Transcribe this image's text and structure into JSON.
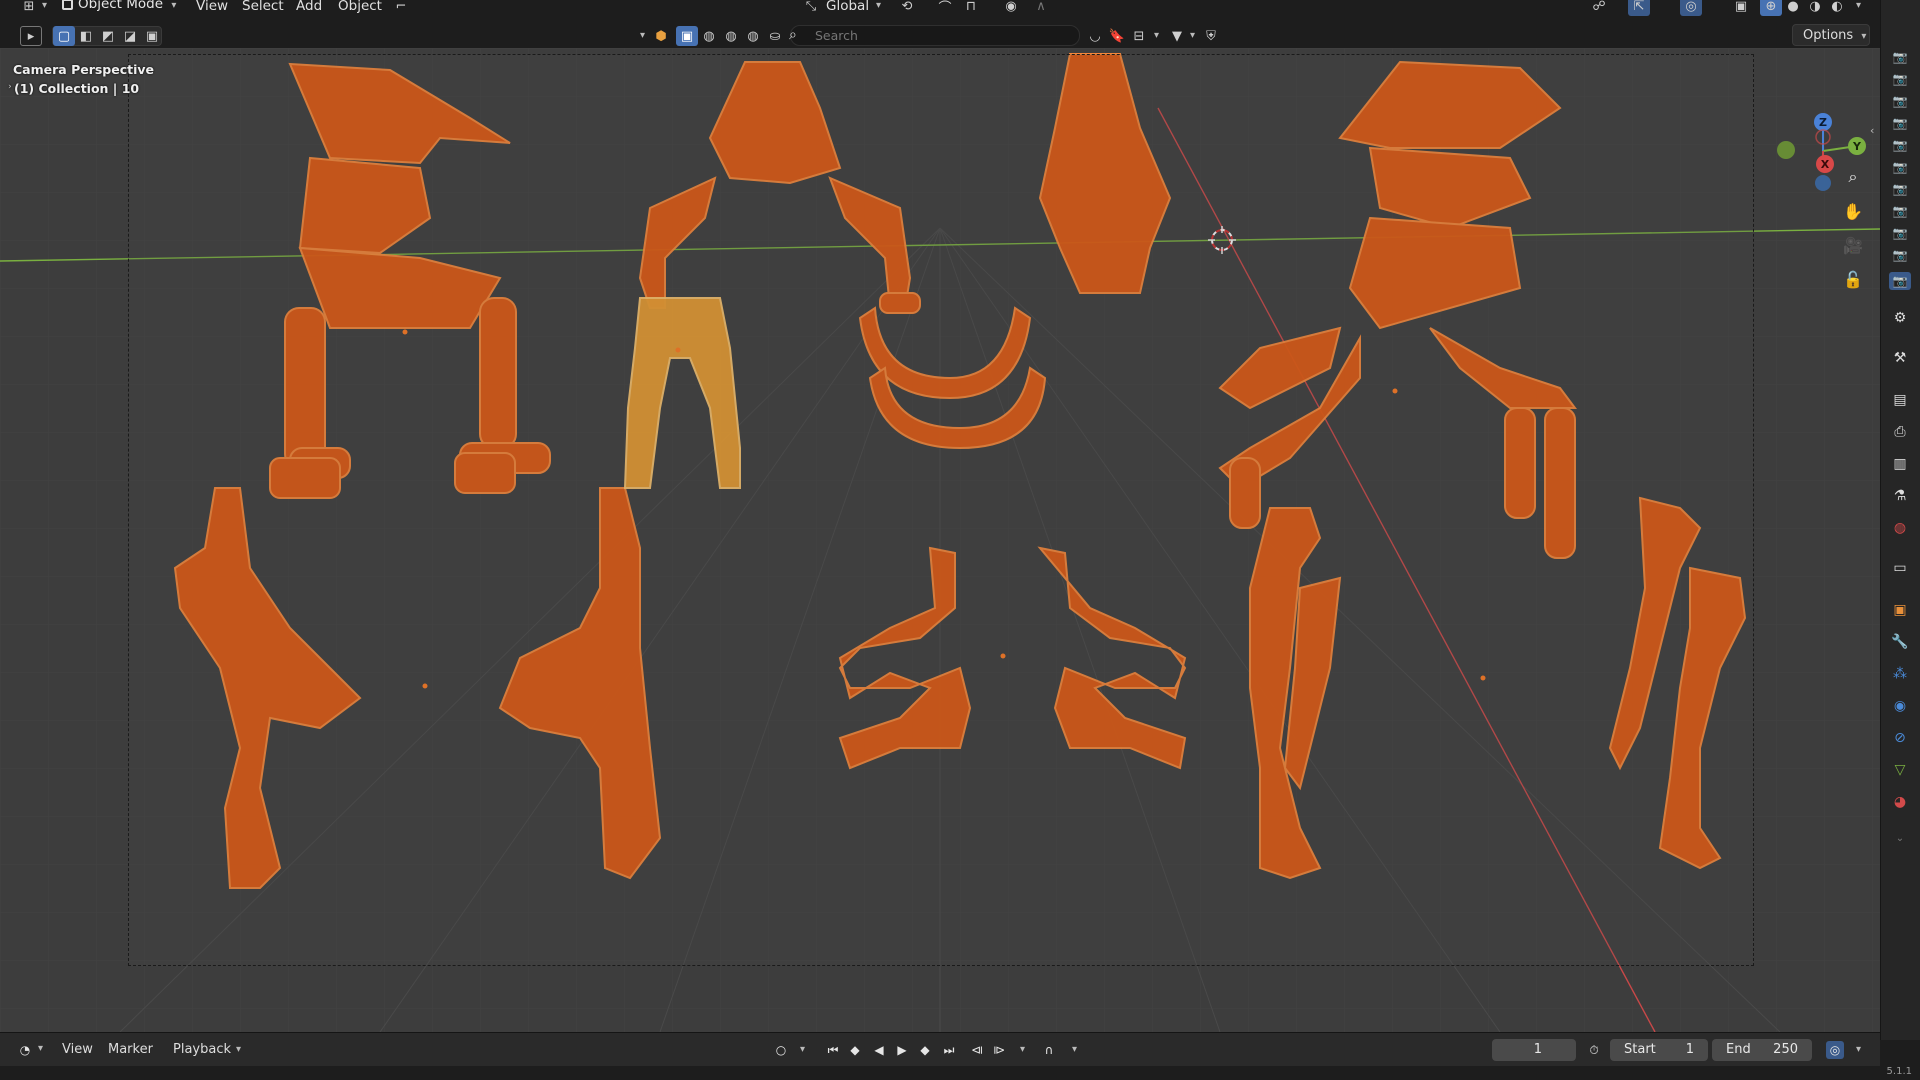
{
  "header": {
    "mode_label": "Object Mode",
    "menus": [
      "View",
      "Select",
      "Add",
      "Object"
    ],
    "transform_orientation": "Global",
    "search_placeholder": "Search",
    "options_label": "Options"
  },
  "viewport": {
    "perspective_label": "Camera Perspective",
    "collection_label": "(1) Collection | 10",
    "gizmo_axes": {
      "z": "Z",
      "y": "Y",
      "x": "X"
    },
    "colors": {
      "background": "#3d3d3d",
      "selected_object": "#e85a10",
      "active_object": "#f0a030",
      "x_axis": "#c84848",
      "y_axis": "#7ab040",
      "z_axis": "#4a82d8"
    }
  },
  "timeline": {
    "menus": [
      "View",
      "Marker",
      "Playback"
    ],
    "current_frame": "1",
    "start_label": "Start",
    "start_value": "1",
    "end_label": "End",
    "end_value": "250"
  },
  "status": {
    "version": "5.1.1"
  }
}
